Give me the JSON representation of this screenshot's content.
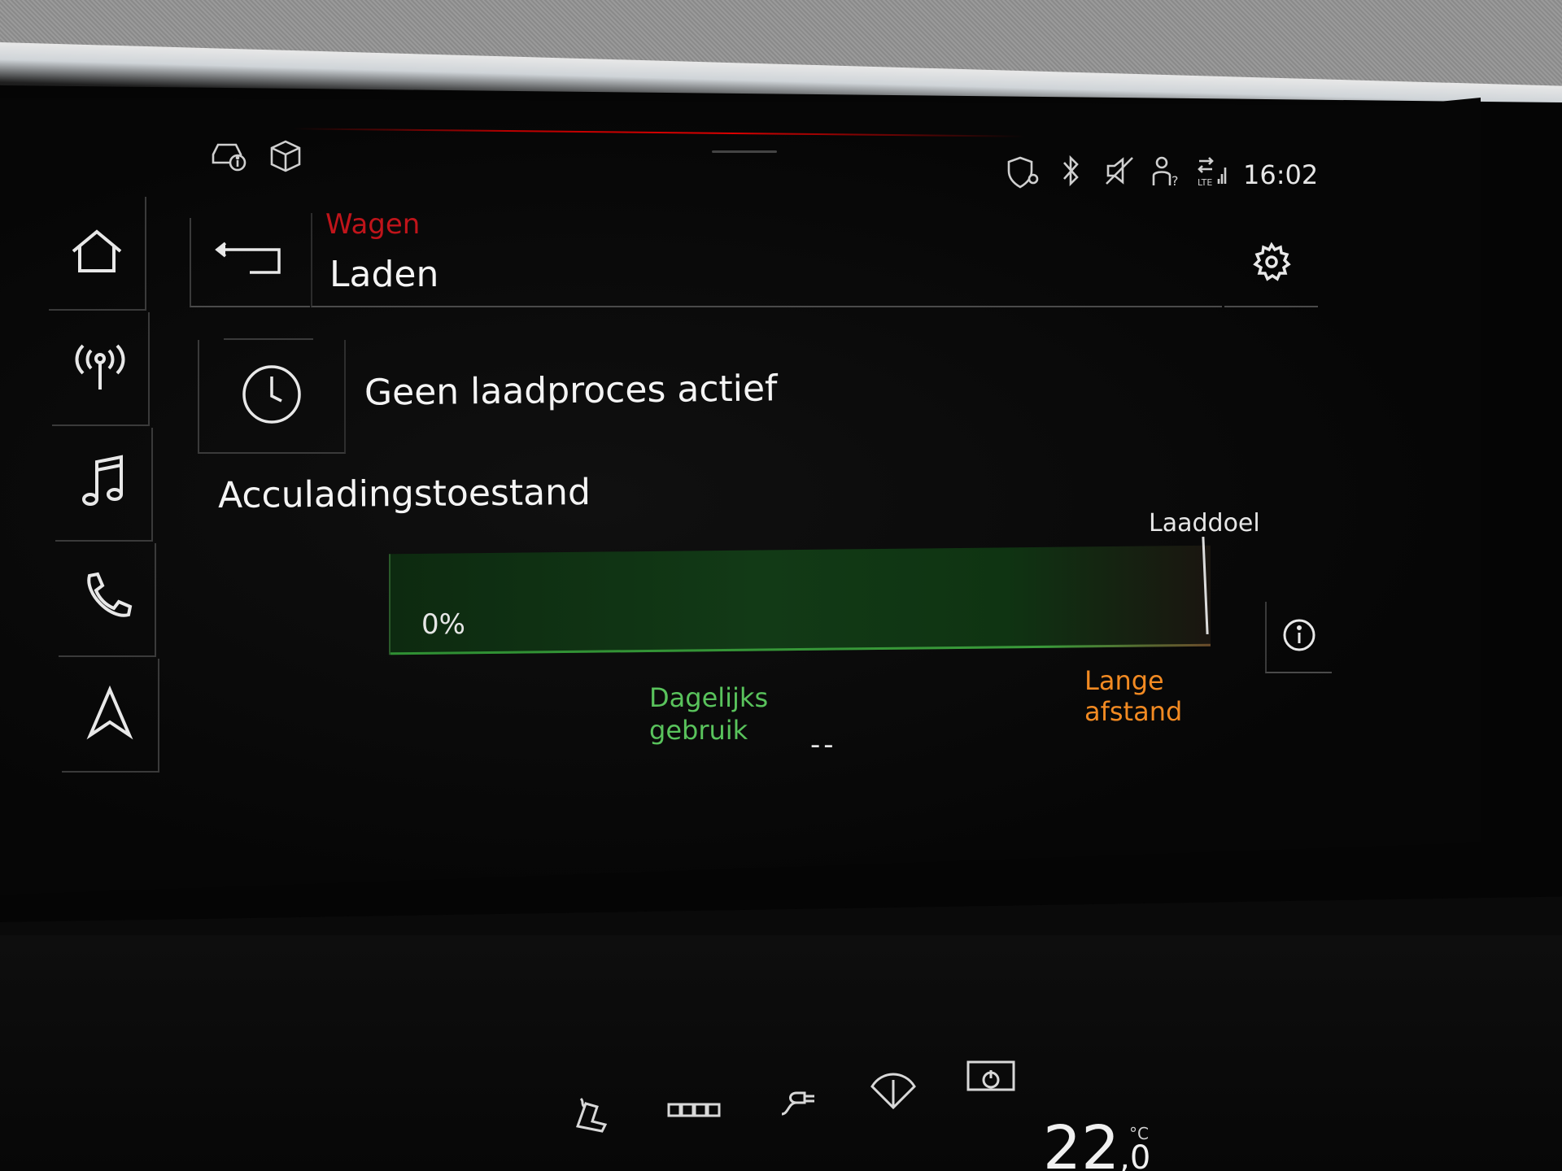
{
  "status_bar": {
    "time": "16:02",
    "left_icons": [
      "car-info-icon",
      "package-icon"
    ],
    "right_icons": [
      "shield-location-icon",
      "bluetooth-icon",
      "mute-icon",
      "user-help-icon",
      "lte-signal-icon"
    ]
  },
  "nav": {
    "items": [
      {
        "name": "home",
        "icon": "home-icon"
      },
      {
        "name": "radio",
        "icon": "antenna-icon"
      },
      {
        "name": "media",
        "icon": "music-note-icon"
      },
      {
        "name": "phone",
        "icon": "phone-icon"
      },
      {
        "name": "navigation",
        "icon": "navigation-arrow-icon"
      }
    ]
  },
  "header": {
    "breadcrumb": "Wagen",
    "title": "Laden",
    "back_icon": "back-arrow-icon",
    "settings_icon": "gear-icon"
  },
  "charge": {
    "status_text": "Geen laadproces actief",
    "timer_icon": "clock-icon"
  },
  "battery": {
    "section_title": "Acculadingstoestand",
    "percent_label": "0%",
    "level": 0,
    "target_label": "Laaddoel",
    "daily_label_line1": "Dagelijks",
    "daily_label_line2": "gebruik",
    "daily_value": "--",
    "long_label_line1": "Lange",
    "long_label_line2": "afstand",
    "info_icon": "info-icon"
  },
  "colors": {
    "accent_red": "#c0141a",
    "daily_green": "#59c35c",
    "long_orange": "#f28a22"
  },
  "console": {
    "temperature": "22",
    "temperature_decimal": ",0",
    "unit": "°C",
    "icons": [
      "seat-heat-icon",
      "rear-defrost-icon",
      "charging-plug-icon",
      "wiper-off-icon",
      "power-icon"
    ]
  }
}
